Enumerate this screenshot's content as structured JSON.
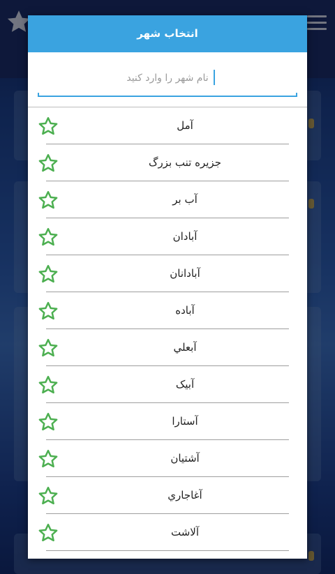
{
  "dialog": {
    "title": "انتخاب شهر",
    "search": {
      "placeholder": "نام شهر را وارد کنید",
      "value": ""
    }
  },
  "cities": [
    {
      "name": "آمل"
    },
    {
      "name": "جزیره تنب بزرگ"
    },
    {
      "name": "آب بر"
    },
    {
      "name": "آبادان"
    },
    {
      "name": "آبادانان"
    },
    {
      "name": "آباده"
    },
    {
      "name": "آبعلي"
    },
    {
      "name": "آبیک"
    },
    {
      "name": "آستارا"
    },
    {
      "name": "آشتیان"
    },
    {
      "name": "آغاجاري"
    },
    {
      "name": "آلاشت"
    }
  ],
  "colors": {
    "header": "#3aa3e0",
    "star_outline": "#4caf50",
    "divider": "#9e9e9e"
  },
  "icons": {
    "favorite": "star-outline-icon",
    "menu": "hamburger-menu-icon"
  }
}
